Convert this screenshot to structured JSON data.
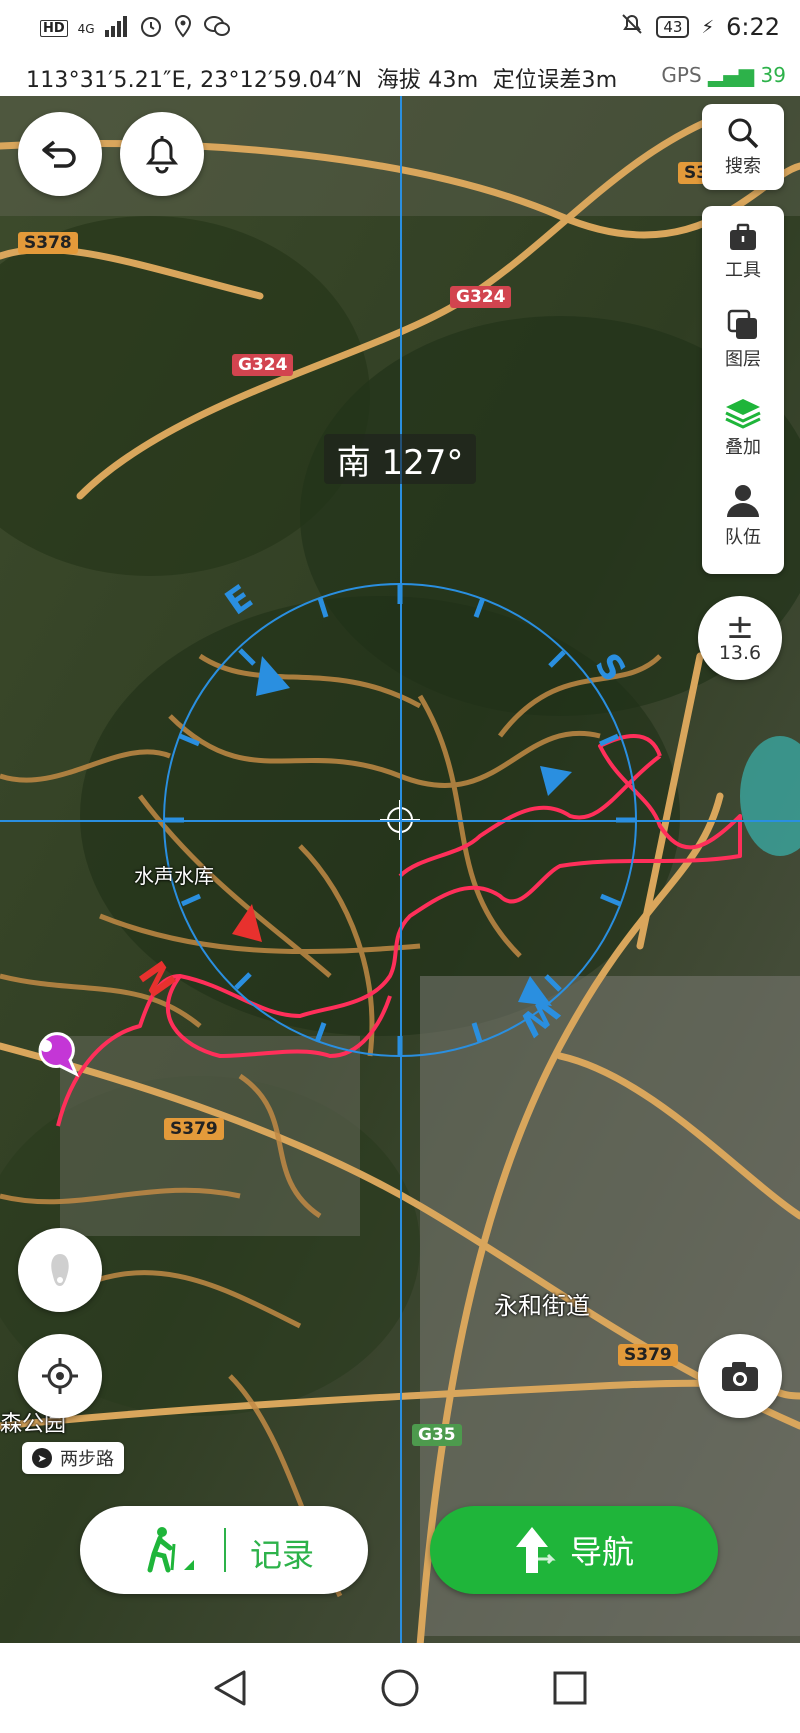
{
  "statusbar": {
    "left_icons": [
      "HD",
      "4G",
      "signal-icon",
      "alarm-icon",
      "location-icon",
      "wechat-icon"
    ],
    "battery": "43",
    "time": "6:22"
  },
  "info": {
    "coords": "113°31′5.21″E, 23°12′59.04″N",
    "altitude_label": "海拔 43m",
    "accuracy_label": "定位误差3m",
    "gps_label": "GPS",
    "gps_count": "39"
  },
  "heading": "南 127°",
  "toolbar": {
    "search_label": "搜索",
    "items": [
      {
        "label": "工具",
        "icon": "toolbox-icon"
      },
      {
        "label": "图层",
        "icon": "layers-icon"
      },
      {
        "label": "叠加",
        "icon": "overlay-icon"
      },
      {
        "label": "队伍",
        "icon": "team-icon"
      }
    ]
  },
  "zoom": {
    "symbol": "±",
    "level": "13.6"
  },
  "map_labels": {
    "reservoir": "水声水库",
    "district": "永和街道",
    "park": "森公园"
  },
  "roads": {
    "s378": "S378",
    "g324_a": "G324",
    "g324_b": "G324",
    "s3_partial": "S3",
    "s379_a": "S379",
    "s379_b": "S379",
    "g35": "G35"
  },
  "walk_pill": "两步路",
  "bottom": {
    "record_label": "记录",
    "nav_label": "导航"
  },
  "colors": {
    "accent_green": "#1fb53a",
    "track_red": "#ff2f5a",
    "compass_blue": "#2a8fe0"
  }
}
